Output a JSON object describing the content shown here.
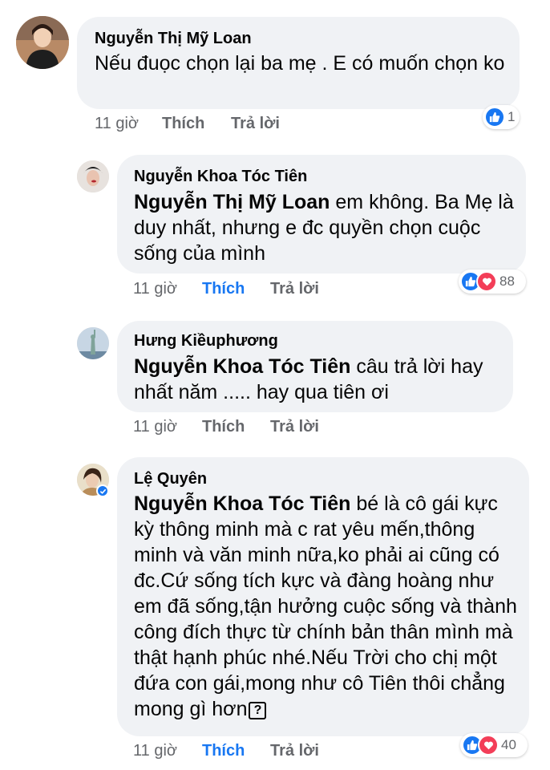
{
  "comments": [
    {
      "author": "Nguyễn Thị Mỹ Loan",
      "mention": "",
      "text": "Nếu đuọc chọn lại ba mẹ . E có muốn chọn ko",
      "time": "11 giờ",
      "like_label": "Thích",
      "reply_label": "Trả lời",
      "reaction_count": "1",
      "reactions": [
        "like"
      ]
    },
    {
      "author": "Nguyễn Khoa Tóc Tiên",
      "mention": "Nguyễn Thị Mỹ Loan",
      "text": " em không. Ba Mẹ là duy nhất, nhưng e đc quyền chọn cuộc sống của mình",
      "time": "11 giờ",
      "like_label": "Thích",
      "reply_label": "Trả lời",
      "reaction_count": "88",
      "reactions": [
        "like",
        "love"
      ]
    },
    {
      "author": "Hưng Kiềuphương",
      "mention": "Nguyễn Khoa Tóc Tiên",
      "text": " câu trả lời hay nhất năm ..... hay qua tiên ơi",
      "time": "11 giờ",
      "like_label": "Thích",
      "reply_label": "Trả lời",
      "reaction_count": "",
      "reactions": []
    },
    {
      "author": "Lệ Quyên",
      "mention": "Nguyễn Khoa Tóc Tiên",
      "text": " bé là cô gái kực kỳ thông minh mà c rat yêu mến,thông minh và văn minh nữa,ko phải ai cũng có đc.Cứ sống tích kực và đàng hoàng như em đã sống,tận hưởng cuộc sống và thành công đích thực từ chính bản thân mình mà thật hạnh phúc nhé.Nếu Trời cho chị một đứa con gái,mong như cô Tiên thôi chẳng mong gì hơn",
      "unknown_glyph": "?",
      "time": "11 giờ",
      "like_label": "Thích",
      "reply_label": "Trả lời",
      "reaction_count": "40",
      "reactions": [
        "like",
        "love"
      ],
      "verified": true
    }
  ],
  "colors": {
    "bubble": "#f0f2f5",
    "meta": "#65676b",
    "liked": "#1877f2",
    "like_react": "#1877f2",
    "love_react": "#f33e58"
  }
}
